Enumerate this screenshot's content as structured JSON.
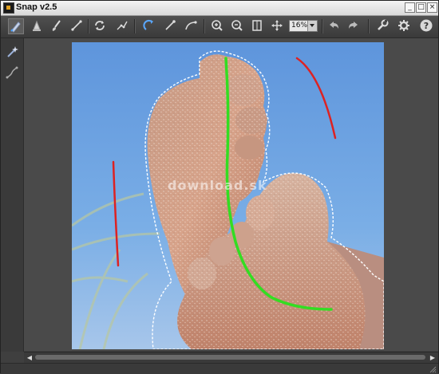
{
  "window": {
    "title": "Snap v2.5",
    "controls": {
      "minimize": "_",
      "maximize": "□",
      "close": "×"
    }
  },
  "toolbar": {
    "zoom_value": "16%",
    "buttons": [
      "paint-selection-icon",
      "eraser-icon",
      "paint-brush-icon",
      "line-icon",
      "refresh-icon",
      "polyline-icon",
      "rotate-icon",
      "pen-line-icon",
      "curve-icon",
      "zoom-in-icon",
      "zoom-out-icon",
      "fit-icon",
      "pan-icon",
      "undo-icon",
      "redo-icon",
      "wrench-icon",
      "gear-icon",
      "help-icon"
    ]
  },
  "side_tools": [
    "magic-wand-icon",
    "path-icon"
  ],
  "watermark": "download.sk",
  "colors": {
    "stroke_foreground": "#33dd22",
    "stroke_background": "#dd2222",
    "selection": "#ffffff",
    "window_bg": "#3f3f3f",
    "sky": "#6aa0e0"
  }
}
